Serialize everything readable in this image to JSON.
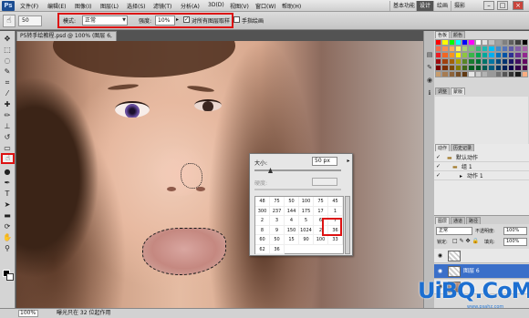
{
  "menubar": {
    "logo": "Ps",
    "items": [
      "文件(F)",
      "编辑(E)",
      "图像(I)",
      "图层(L)",
      "选择(S)",
      "滤镜(T)",
      "分析(A)",
      "3D(D)",
      "视图(V)",
      "窗口(W)",
      "帮助(H)"
    ],
    "workspaces": [
      "基本功能",
      "设计",
      "绘画",
      "摄影"
    ],
    "active_workspace": "设计",
    "window_buttons": [
      "–",
      "□",
      "×"
    ]
  },
  "options": {
    "brush_size": "50",
    "mode_label": "模式:",
    "mode_value": "正常",
    "strength_label": "强度:",
    "strength_value": "10%",
    "sample_all_layers": "对所有图层取样",
    "finger_painting": "手指绘画"
  },
  "document": {
    "tab_title": "P5转手绘教程.psd @ 100% (图层 6, RGB/8) *"
  },
  "brush_picker": {
    "size_label": "大小:",
    "size_value": "50 px",
    "hardness_label": "硬度:",
    "presets": [
      "48",
      "75",
      "50",
      "100",
      "75",
      "45",
      "300",
      "237",
      "144",
      "175",
      "17",
      "1",
      "2",
      "3",
      "4",
      "5",
      "6",
      "7",
      "8",
      "9",
      "150",
      "1024",
      "2",
      "36",
      "60",
      "50",
      "15",
      "90",
      "100",
      "33",
      "62",
      "36"
    ]
  },
  "panels": {
    "color_tabs": [
      "色板",
      "颜色"
    ],
    "adjust_tabs": [
      "调整",
      "蒙版"
    ],
    "actions_tabs": [
      "动作",
      "历史记录"
    ],
    "actions": [
      {
        "label": "默认动作",
        "checked": true
      },
      {
        "label": "组 1",
        "checked": true
      },
      {
        "label": "动作 1",
        "checked": true
      }
    ],
    "layers_tabs": [
      "图层",
      "通道",
      "路径"
    ],
    "blend_mode": "正常",
    "opacity_label": "不透明度:",
    "opacity_value": "100%",
    "lock_label": "锁定:",
    "fill_label": "填充:",
    "fill_value": "100%",
    "layers": [
      {
        "name": "",
        "selected": false
      },
      {
        "name": "图层 6",
        "selected": true
      },
      {
        "name": "",
        "selected": false
      }
    ],
    "swatch_colors": [
      "#ff0000",
      "#ffff00",
      "#00ff00",
      "#00ffff",
      "#0000ff",
      "#ff00ff",
      "#ffffff",
      "#e0e0e0",
      "#c0c0c0",
      "#a0a0a0",
      "#808080",
      "#606060",
      "#404040",
      "#000000",
      "#f26c4f",
      "#f68e56",
      "#fbaf5d",
      "#fff568",
      "#acd373",
      "#7cc576",
      "#3bb878",
      "#1abbb4",
      "#00bff3",
      "#438ccb",
      "#5574b9",
      "#605ca8",
      "#855fa8",
      "#a763a8",
      "#ed1c24",
      "#f26522",
      "#f7941d",
      "#fff200",
      "#8dc63f",
      "#39b54a",
      "#00a651",
      "#00a99d",
      "#00aeef",
      "#0072bc",
      "#0054a6",
      "#2e3192",
      "#662d91",
      "#92278f",
      "#9e0b0f",
      "#a0410d",
      "#a36209",
      "#aba000",
      "#598527",
      "#197b30",
      "#007236",
      "#00746b",
      "#0076a3",
      "#004b80",
      "#003471",
      "#1b1464",
      "#440e62",
      "#630460",
      "#790000",
      "#7b2e00",
      "#7d4900",
      "#827b00",
      "#406618",
      "#005e20",
      "#005826",
      "#005952",
      "#005b7f",
      "#003663",
      "#002157",
      "#0d004c",
      "#32004b",
      "#4b0049",
      "#c69c6d",
      "#a67c52",
      "#8c6239",
      "#754c24",
      "#603913",
      "#e6e6e6",
      "#cccccc",
      "#b3b3b3",
      "#999999",
      "#737373",
      "#555555",
      "#333333",
      "#1a1a1a",
      "#f9ad81"
    ],
    "actions_highlight": "#3a6fc9"
  },
  "status": {
    "zoom": "100%",
    "info": "曝光只在 32 位起作用"
  },
  "watermark": {
    "text": "UiBQ.CoM",
    "url": "www.psahz.com"
  },
  "highlight_color": "#d11"
}
